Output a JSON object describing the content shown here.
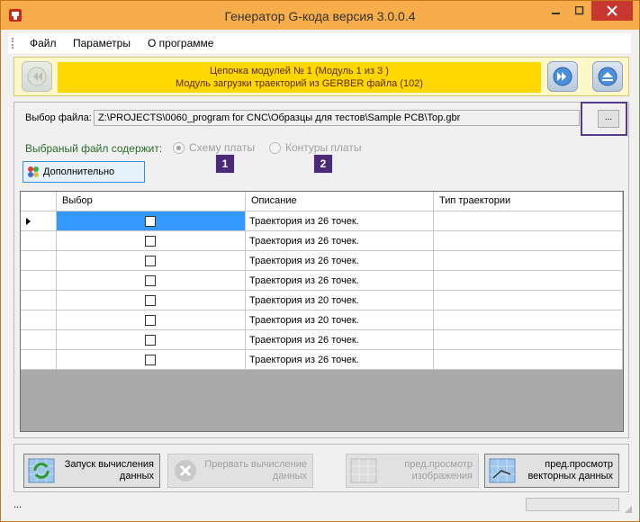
{
  "window": {
    "title": "Генератор G-кода версия 3.0.0.4",
    "border_color": "#c2771c",
    "titlebar_color": "#f6ad4a"
  },
  "menu": {
    "items": [
      "Файл",
      "Параметры",
      "О программе"
    ]
  },
  "toolbar": {
    "chain_line1": "Цепочка модулей № 1 (Модуль 1 из 3 )",
    "chain_line2": "Модуль загрузки траекторий из GERBER файла (102)",
    "prev_icon": "double-left-arrow-icon",
    "next_icon": "double-right-arrow-icon",
    "eject_icon": "eject-icon",
    "accent_color": "#ffd700"
  },
  "file": {
    "label": "Выбор файла:",
    "path": "Z:\\PROJECTS\\0060_program for CNC\\Образцы для тестов\\Sample PCB\\Top.gbr",
    "browse_label": "...",
    "contains_label": "Выбраный файл содержит:",
    "option1": "Схему платы",
    "option2": "Контуры платы",
    "option1_selected": true,
    "badge1": "1",
    "badge2": "2"
  },
  "more_button": {
    "label": "Дополнительно"
  },
  "table": {
    "columns": [
      "Выбор",
      "Описание",
      "Тип траектории"
    ],
    "rows": [
      {
        "description": "Траектория из 26 точек.",
        "type": "",
        "checked": false
      },
      {
        "description": "Траектория из 26 точек.",
        "type": "",
        "checked": false
      },
      {
        "description": "Траектория из 26 точек.",
        "type": "",
        "checked": false
      },
      {
        "description": "Траектория из 26 точек.",
        "type": "",
        "checked": false
      },
      {
        "description": "Траектория из 20 точек.",
        "type": "",
        "checked": false
      },
      {
        "description": "Траектория из 20 точек.",
        "type": "",
        "checked": false
      },
      {
        "description": "Траектория из 26 точек.",
        "type": "",
        "checked": false
      },
      {
        "description": "Траектория из 26 точек.",
        "type": "",
        "checked": false
      }
    ],
    "selected_color": "#3399ff"
  },
  "buttons": {
    "start_l1": "Запуск вычисления",
    "start_l2": "данных",
    "stop_l1": "Прервать вычисление",
    "stop_l2": "данных",
    "preview_img_l1": "пред.просмотр",
    "preview_img_l2": "изображения",
    "preview_vec_l1": "пред.просмотр",
    "preview_vec_l2": "векторных данных"
  },
  "status": {
    "text": "..."
  }
}
